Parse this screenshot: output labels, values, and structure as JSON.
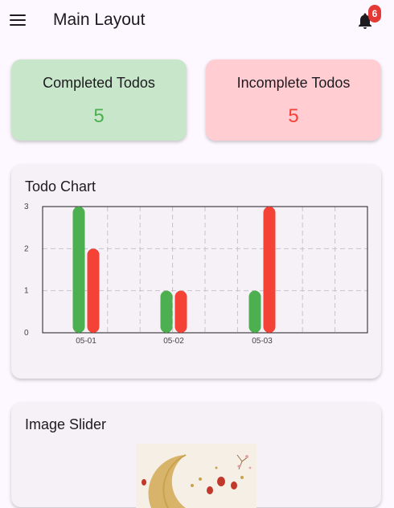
{
  "appbar": {
    "title": "Main Layout",
    "notification_count": "6"
  },
  "stats": {
    "completed": {
      "label": "Completed Todos",
      "value": "5"
    },
    "incomplete": {
      "label": "Incomplete Todos",
      "value": "5"
    }
  },
  "chart_section": {
    "title": "Todo Chart"
  },
  "chart_data": {
    "type": "bar",
    "categories": [
      "05-01",
      "05-02",
      "05-03"
    ],
    "series": [
      {
        "values": [
          3,
          1,
          1
        ],
        "color": "#4caf50"
      },
      {
        "values": [
          2,
          1,
          3
        ],
        "color": "#f44336"
      }
    ],
    "ylim": [
      0,
      3
    ],
    "yticks": [
      "0",
      "1",
      "2",
      "3"
    ],
    "grid": true,
    "grid_style": "dashed"
  },
  "slider_section": {
    "title": "Image Slider"
  },
  "colors": {
    "completed_bg": "#c8e6c9",
    "incomplete_bg": "#ffcdd2",
    "completed_accent": "#4caf50",
    "incomplete_accent": "#f44336",
    "badge": "#e53935"
  }
}
